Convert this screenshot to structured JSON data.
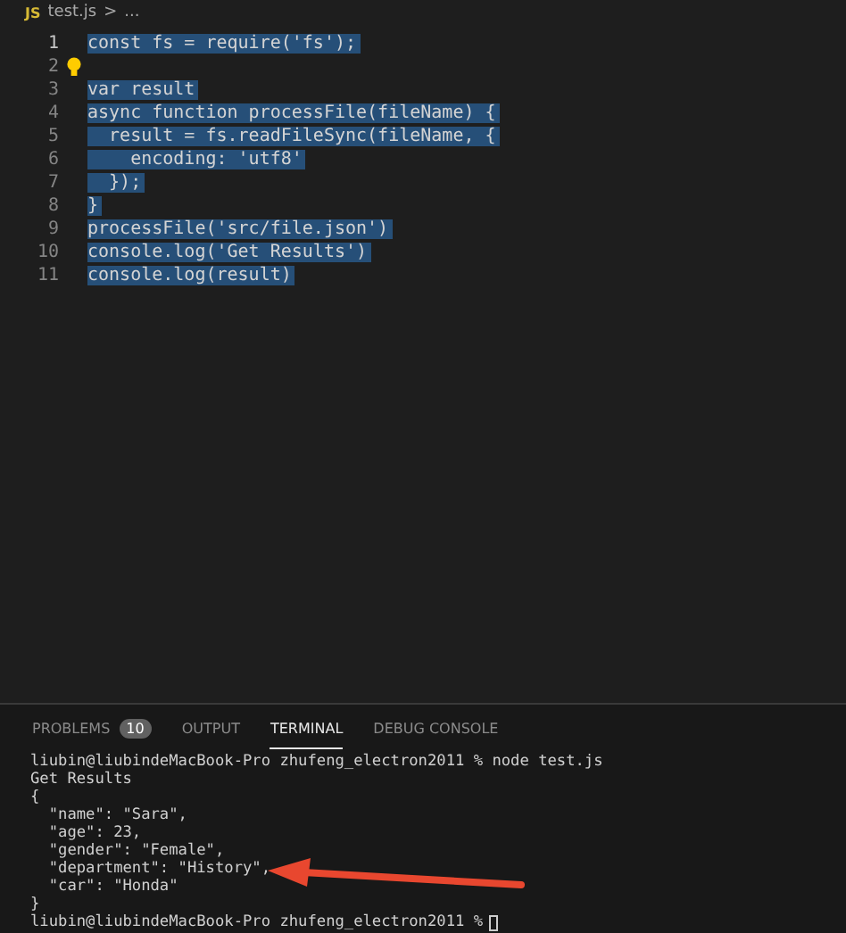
{
  "breadcrumb": {
    "file_icon": "JS",
    "file": "test.js",
    "separator": ">",
    "rest": "..."
  },
  "code_lines": [
    {
      "number": "1",
      "text": "const fs = require('fs');"
    },
    {
      "number": "2"
    },
    {
      "number": "3",
      "text": "var result"
    },
    {
      "number": "4",
      "text": "async function processFile(fileName) {"
    },
    {
      "number": "5",
      "text": "  result = fs.readFileSync(fileName, {"
    },
    {
      "number": "6",
      "text": "    encoding: 'utf8'"
    },
    {
      "number": "7",
      "text": "  });"
    },
    {
      "number": "8",
      "text": "}"
    },
    {
      "number": "9",
      "text": "processFile('src/file.json')"
    },
    {
      "number": "10",
      "text": "console.log('Get Results')"
    },
    {
      "number": "11",
      "text": "console.log(result)"
    }
  ],
  "panel_tabs": [
    {
      "label": "PROBLEMS",
      "badge": "10",
      "selected": false
    },
    {
      "label": "OUTPUT",
      "selected": false
    },
    {
      "label": "TERMINAL",
      "selected": true
    },
    {
      "label": "DEBUG CONSOLE",
      "selected": false
    }
  ],
  "terminal_lines": [
    "liubin@liubindeMacBook-Pro zhufeng_electron2011 % node test.js",
    "Get Results",
    "{",
    "  \"name\": \"Sara\",",
    "  \"age\": 23,",
    "  \"gender\": \"Female\",",
    "  \"department\": \"History\",",
    "  \"car\": \"Honda\"",
    "}",
    "liubin@liubindeMacBook-Pro zhufeng_electron2011 %"
  ]
}
